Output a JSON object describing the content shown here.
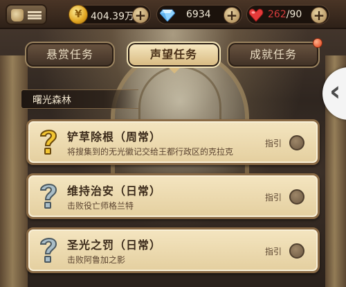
{
  "resources": {
    "gold": "404.39万",
    "diamonds": "6934",
    "stamina_current": "262",
    "stamina_separator": "/",
    "stamina_max": "90"
  },
  "tabs": [
    {
      "label": "悬赏任务",
      "active": false
    },
    {
      "label": "声望任务",
      "active": true
    },
    {
      "label": "成就任务",
      "active": false,
      "notification": true
    }
  ],
  "region": {
    "name": "曙光森林"
  },
  "quests": [
    {
      "title": "铲草除根（周常）",
      "desc": "将搜集到的无光徽记交给王都行政区的克拉克",
      "guide": "指引",
      "icon": "question-gold-icon"
    },
    {
      "title": "维持治安（日常）",
      "desc": "击败役亡师格兰特",
      "guide": "指引",
      "icon": "question-silver-icon"
    },
    {
      "title": "圣光之罚（日常）",
      "desc": "击败阿鲁加之影",
      "guide": "指引",
      "icon": "question-silver-icon"
    }
  ],
  "colors": {
    "accent_gold": "#d7b97f",
    "stamina_red": "#d63c3c",
    "notification": "#e04018"
  }
}
